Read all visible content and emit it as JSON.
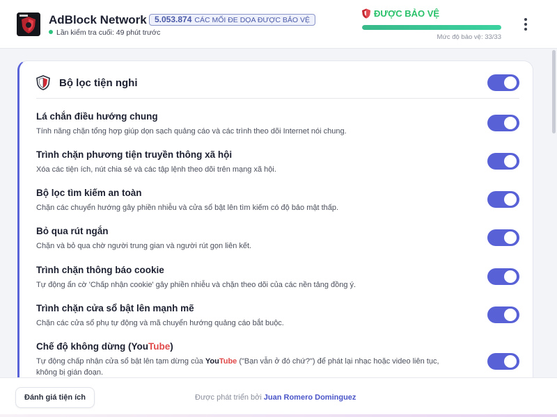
{
  "header": {
    "app_title": "AdBlock Network",
    "threat_count": "5.053.874",
    "threat_label": "CÁC MỐI ĐE DỌA ĐƯỢC BẢO VỆ",
    "last_check": "Lần kiểm tra cuối: 49 phút trước",
    "status": "ĐƯỢC BẢO VỆ",
    "protection_level_text": "Mức độ bảo vệ: 33/33",
    "protection_progress": 1.0,
    "status_color": "#29c16a",
    "logo_icon": "adblock-logo-icon",
    "menu_icon": "kebab-menu-icon"
  },
  "card": {
    "title": "Bộ lọc tiện nghi",
    "icon": "shield-icon",
    "master_toggle": true,
    "accent_color": "#5861d6"
  },
  "filters": [
    {
      "title": "Lá chắn điều hướng chung",
      "desc": "Tính năng chặn tổng hợp giúp dọn sạch quảng cáo và các trình theo dõi Internet nói chung.",
      "enabled": true
    },
    {
      "title": "Trình chặn phương tiện truyền thông xã hội",
      "desc": "Xóa các tiện ích, nút chia sẻ và các tập lệnh theo dõi trên mạng xã hội.",
      "enabled": true
    },
    {
      "title": "Bộ lọc tìm kiếm an toàn",
      "desc": "Chặn các chuyển hướng gây phiền nhiễu và cửa sổ bật lên tìm kiếm có độ bảo mật thấp.",
      "enabled": true
    },
    {
      "title": "Bỏ qua rút ngắn",
      "desc": "Chặn và bỏ qua chờ người trung gian và người rút gọn liên kết.",
      "enabled": true
    },
    {
      "title": "Trình chặn thông báo cookie",
      "desc": "Tự động ẩn cờ 'Chấp nhận cookie' gây phiền nhiễu và chặn theo dõi của các nền tảng đồng ý.",
      "enabled": true
    },
    {
      "title": "Trình chặn cửa sổ bật lên mạnh mẽ",
      "desc": "Chặn các cửa sổ phụ tự động và mã chuyển hướng quảng cáo bắt buộc.",
      "enabled": true
    },
    {
      "title_prefix": "Chế độ không dừng (",
      "title_you": "You",
      "title_tube": "Tube",
      "title_suffix": ")",
      "desc_prefix": "Tự động chấp nhận cửa sổ bật lên tạm dừng của ",
      "desc_you": "You",
      "desc_tube": "Tube",
      "desc_suffix": " (\"Bạn vẫn ở đó chứ?\") để phát lại nhạc hoặc video liên tục, không bị gián đoạn.",
      "enabled": true
    }
  ],
  "footer": {
    "rate_button": "Đánh giá tiện ích",
    "dev_prefix": "Được phát triển bởi",
    "dev_name": "Juan Romero Dominguez"
  }
}
